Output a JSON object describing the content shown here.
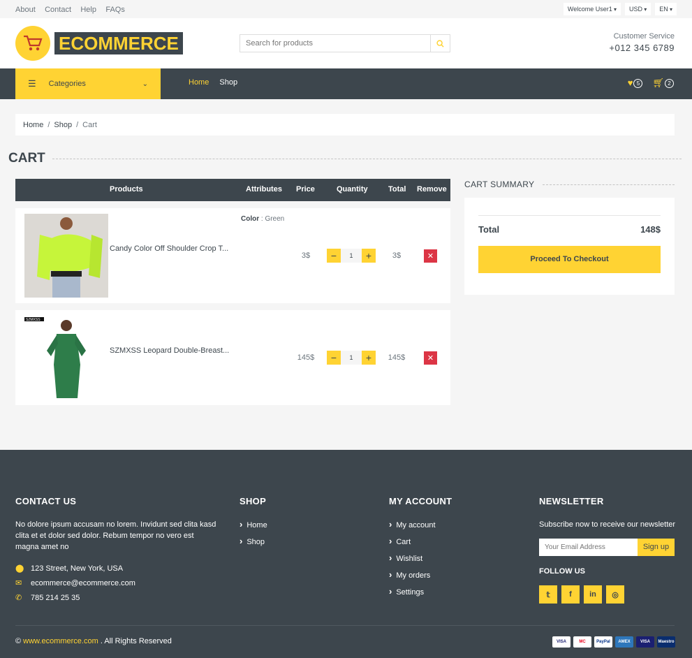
{
  "topbar": {
    "links": [
      "About",
      "Contact",
      "Help",
      "FAQs"
    ],
    "user_menu": "Welcome User1",
    "currency": "USD",
    "language": "EN"
  },
  "header": {
    "logo_text": "ECOMMERCE",
    "search_placeholder": "Search for products",
    "customer_service_label": "Customer Service",
    "phone": "+012 345 6789"
  },
  "nav": {
    "categories_label": "Categories",
    "links": [
      {
        "label": "Home",
        "active": true
      },
      {
        "label": "Shop",
        "active": false
      }
    ],
    "wishlist_count": "5",
    "cart_count": "2"
  },
  "breadcrumb": [
    "Home",
    "Shop",
    "Cart"
  ],
  "page_title": "CART",
  "table": {
    "headers": {
      "products": "Products",
      "attributes": "Attributes",
      "price": "Price",
      "quantity": "Quantity",
      "total": "Total",
      "remove": "Remove"
    },
    "rows": [
      {
        "name": "Candy Color Off Shoulder Crop T...",
        "attr_label": "Color",
        "attr_value": "Green",
        "price": "3$",
        "quantity": "1",
        "total": "3$",
        "image_color": "#c6f53a"
      },
      {
        "name": "SZMXSS Leopard Double-Breast...",
        "attr_label": "",
        "attr_value": "",
        "price": "145$",
        "quantity": "1",
        "total": "145$",
        "image_color": "#2e7d4a",
        "image_tag": "SZMXSS"
      }
    ]
  },
  "summary": {
    "title": "CART SUMMARY",
    "total_label": "Total",
    "total_value": "148$",
    "checkout_label": "Proceed To Checkout"
  },
  "footer": {
    "contact": {
      "title": "CONTACT US",
      "text": "No dolore ipsum accusam no lorem. Invidunt sed clita kasd clita et et dolor sed dolor. Rebum tempor no vero est magna amet no",
      "address": "123 Street, New York, USA",
      "email": "ecommerce@ecommerce.com",
      "phone": "785 214 25 35"
    },
    "shop": {
      "title": "SHOP",
      "links": [
        "Home",
        "Shop"
      ]
    },
    "account": {
      "title": "MY ACCOUNT",
      "links": [
        "My account",
        "Cart",
        "Wishlist",
        "My orders",
        "Settings"
      ]
    },
    "newsletter": {
      "title": "NEWSLETTER",
      "text": "Subscribe now to receive our newsletter",
      "placeholder": "Your Email Address",
      "button": "Sign up",
      "follow_label": "FOLLOW US",
      "social": [
        "twitter-icon",
        "facebook-icon",
        "linkedin-icon",
        "instagram-icon"
      ]
    },
    "copyright_prefix": "©",
    "copyright_link": "www.ecommerce.com",
    "copyright_suffix": ". All Rights Reserved",
    "payments": [
      "VISA",
      "MC",
      "PayPal",
      "AMEX",
      "VISA",
      "Maestro"
    ]
  },
  "colors": {
    "accent": "#ffd333",
    "dark": "#3d464d",
    "danger": "#dc3545"
  }
}
